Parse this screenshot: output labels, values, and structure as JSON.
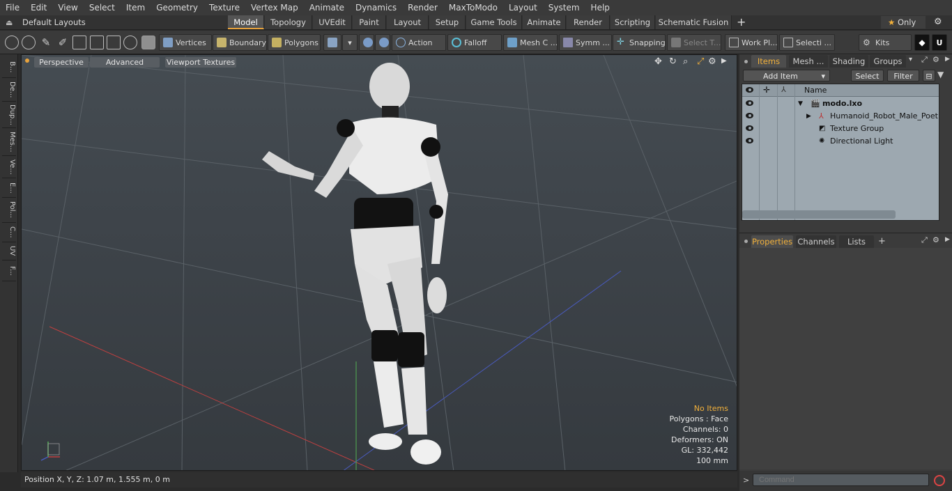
{
  "menu": [
    "File",
    "Edit",
    "View",
    "Select",
    "Item",
    "Geometry",
    "Texture",
    "Vertex Map",
    "Animate",
    "Dynamics",
    "Render",
    "MaxToModo",
    "Layout",
    "System",
    "Help"
  ],
  "layout_dropdown": "Default Layouts",
  "mode_tabs": [
    "Model",
    "Topology",
    "UVEdit",
    "Paint",
    "Layout",
    "Setup",
    "Game Tools",
    "Animate",
    "Render",
    "Scripting",
    "Schematic Fusion"
  ],
  "active_tab": "Model",
  "only_label": "Only",
  "toolbar": {
    "vertices": "Vertices",
    "boundary": "Boundary",
    "polygons": "Polygons",
    "action": "Action",
    "falloff": "Falloff",
    "mesh": "Mesh C ...",
    "symm": "Symm ...",
    "snapping": "Snapping",
    "select_t": "Select T...",
    "work_pl": "Work Pl...",
    "selecti": "Selecti ...",
    "kits": "Kits"
  },
  "left_tabs": [
    "B...",
    "De...",
    "Dup...",
    "Mes...",
    "Ve...",
    "E...",
    "Pol...",
    "C...",
    "UV",
    "F..."
  ],
  "viewport": {
    "perspective": "Perspective",
    "advanced": "Advanced",
    "textures": "Viewport Textures",
    "stats": {
      "no_items": "No Items",
      "polygons": "Polygons : Face",
      "channels": "Channels: 0",
      "deformers": "Deformers: ON",
      "gl": "GL: 332,442",
      "scale": "100 mm"
    }
  },
  "status": {
    "position": "Position X, Y, Z:   1.07 m, 1.555 m, 0 m"
  },
  "items_panel": {
    "tabs": [
      "Items",
      "Mesh ...",
      "Shading",
      "Groups"
    ],
    "add_item": "Add Item",
    "select": "Select",
    "filter": "Filter",
    "col_name": "Name",
    "rows": [
      "modo.lxo",
      "Humanoid_Robot_Male_Poet ...",
      "Texture Group",
      "Directional Light"
    ]
  },
  "props_panel": {
    "tabs": [
      "Properties",
      "Channels",
      "Lists"
    ],
    "plus": "+"
  },
  "command_placeholder": "Command",
  "colors": {
    "accent": "#e8a33d",
    "highlight": "#f2b13b"
  }
}
